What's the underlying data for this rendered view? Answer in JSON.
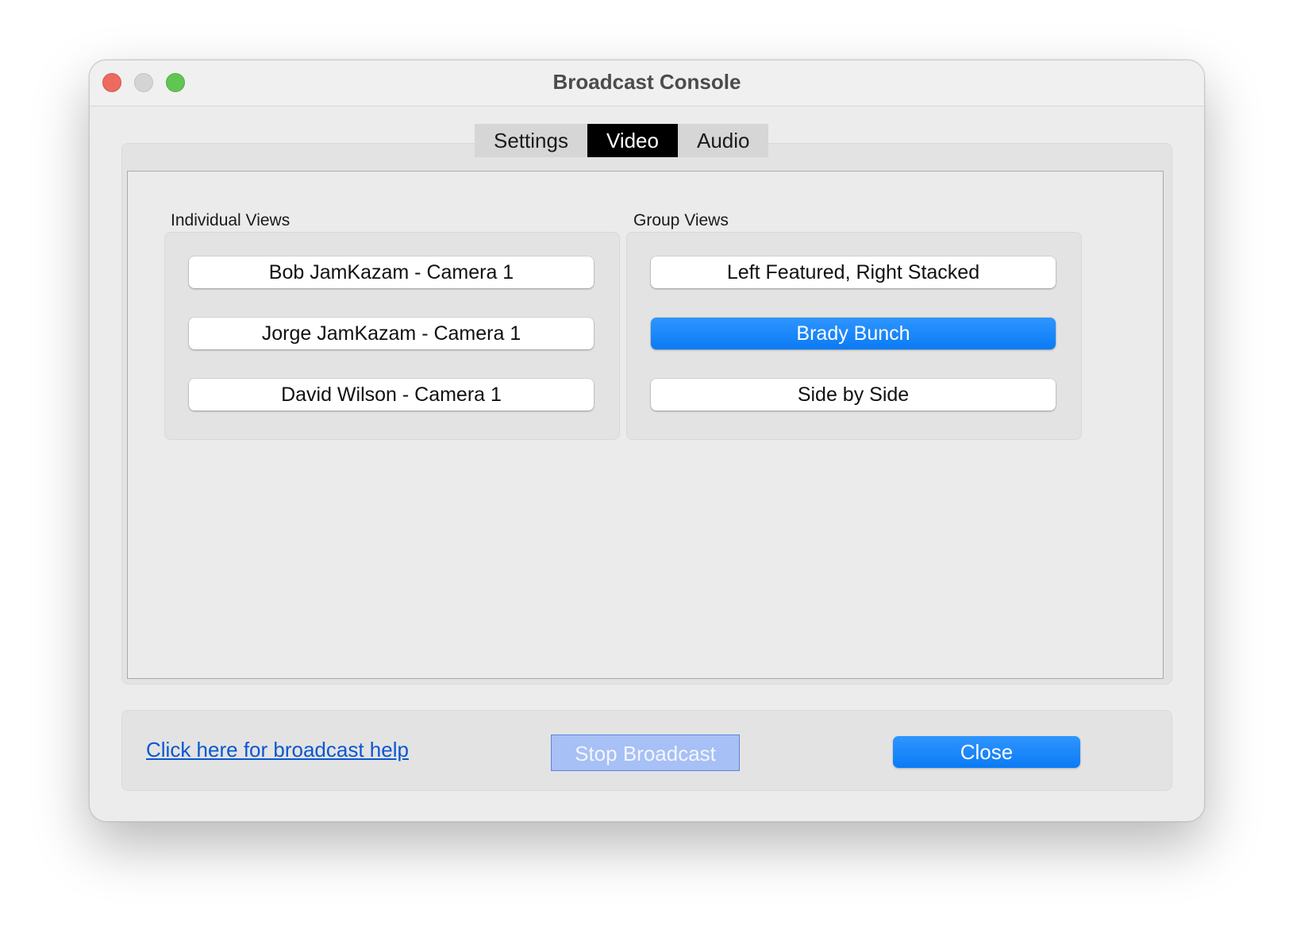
{
  "window": {
    "title": "Broadcast Console"
  },
  "tabs": [
    {
      "label": "Settings",
      "active": false
    },
    {
      "label": "Video",
      "active": true
    },
    {
      "label": "Audio",
      "active": false
    }
  ],
  "individual_views": {
    "label": "Individual Views",
    "buttons": [
      {
        "label": "Bob JamKazam - Camera 1",
        "selected": false
      },
      {
        "label": "Jorge JamKazam - Camera 1",
        "selected": false
      },
      {
        "label": "David Wilson - Camera 1",
        "selected": false
      }
    ]
  },
  "group_views": {
    "label": "Group Views",
    "buttons": [
      {
        "label": "Left Featured, Right Stacked",
        "selected": false
      },
      {
        "label": "Brady Bunch",
        "selected": true
      },
      {
        "label": "Side by Side",
        "selected": false
      }
    ]
  },
  "footer": {
    "help_link": "Click here for broadcast help",
    "stop_button": "Stop Broadcast",
    "close_button": "Close"
  },
  "colors": {
    "accent": "#0a7bf5",
    "link": "#0b57d0",
    "close_traffic": "#ed6a5e",
    "minimize_traffic": "#d4d4d4",
    "maximize_traffic": "#61c554"
  }
}
